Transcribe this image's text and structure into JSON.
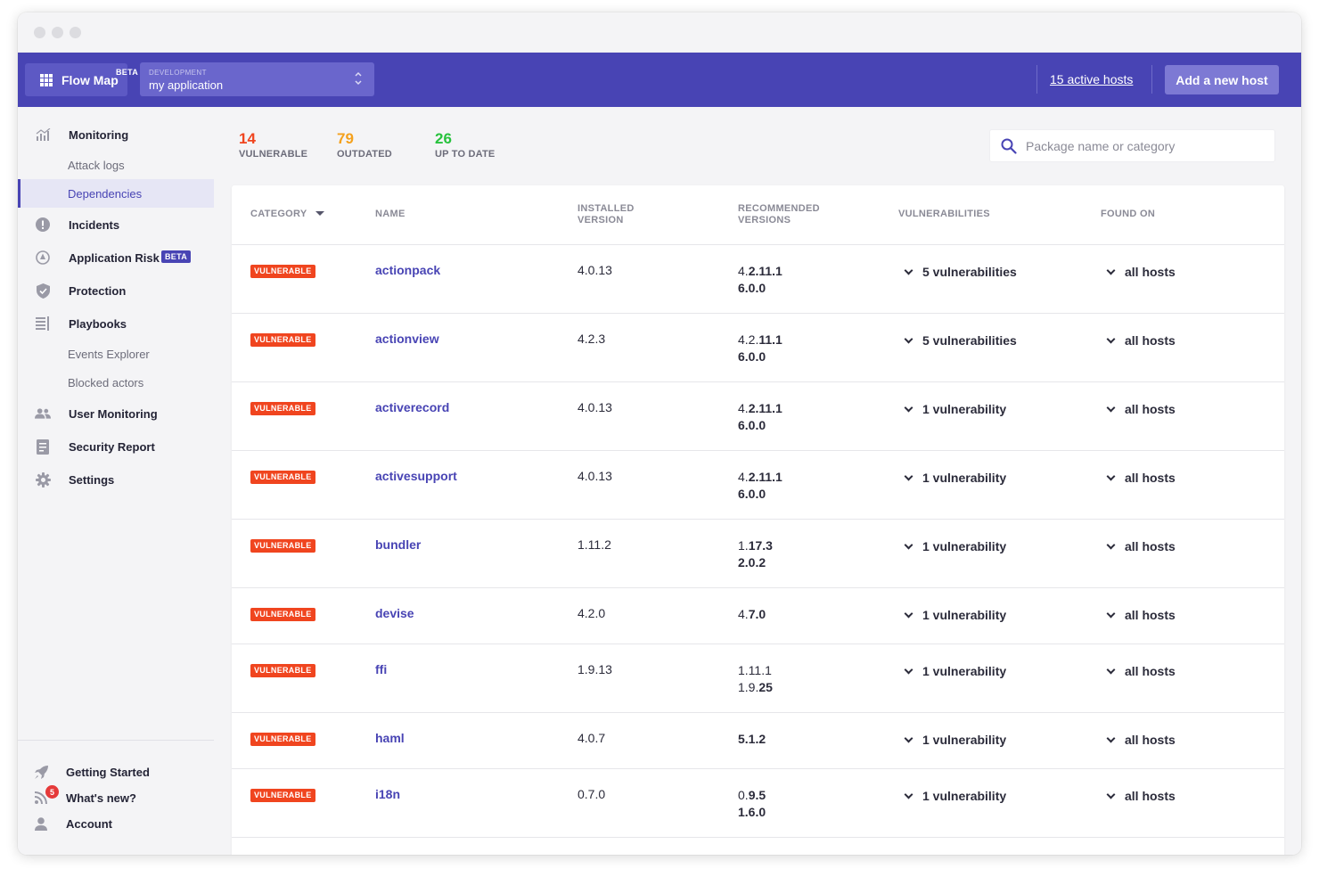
{
  "topbar": {
    "flowmap_label": "Flow Map",
    "flowmap_badge": "BETA",
    "env_label": "DEVELOPMENT",
    "app_name": "my application",
    "active_hosts": "15 active hosts",
    "add_host": "Add a new host"
  },
  "sidebar": {
    "monitoring": "Monitoring",
    "attack_logs": "Attack logs",
    "dependencies": "Dependencies",
    "incidents": "Incidents",
    "application_risk": "Application Risk",
    "application_risk_badge": "BETA",
    "protection": "Protection",
    "playbooks": "Playbooks",
    "events_explorer": "Events Explorer",
    "blocked_actors": "Blocked actors",
    "user_monitoring": "User Monitoring",
    "security_report": "Security Report",
    "settings": "Settings",
    "getting_started": "Getting Started",
    "whats_new": "What's new?",
    "whats_new_count": "5",
    "account": "Account"
  },
  "stats": {
    "vulnerable": {
      "count": "14",
      "label": "VULNERABLE",
      "color": "#f0451f"
    },
    "outdated": {
      "count": "79",
      "label": "OUTDATED",
      "color": "#f4a11d"
    },
    "up_to_date": {
      "count": "26",
      "label": "UP TO DATE",
      "color": "#27c23d"
    }
  },
  "search": {
    "placeholder": "Package name or category"
  },
  "table": {
    "headers": {
      "category": "CATEGORY",
      "name": "NAME",
      "installed_l1": "INSTALLED",
      "installed_l2": "VERSION",
      "recommended_l1": "RECOMMENDED",
      "recommended_l2": "VERSIONS",
      "vulnerabilities": "VULNERABILITIES",
      "found_on": "FOUND ON"
    },
    "rows": [
      {
        "category": "VULNERABLE",
        "name": "actionpack",
        "installed": "4.0.13",
        "recommended": [
          [
            "4.",
            "2.11.1"
          ],
          [
            "",
            "6.0.0"
          ]
        ],
        "vulnerabilities": "5 vulnerabilities",
        "found_on": "all hosts"
      },
      {
        "category": "VULNERABLE",
        "name": "actionview",
        "installed": "4.2.3",
        "recommended": [
          [
            "4.2.",
            "11.1"
          ],
          [
            "",
            "6.0.0"
          ]
        ],
        "vulnerabilities": "5 vulnerabilities",
        "found_on": "all hosts"
      },
      {
        "category": "VULNERABLE",
        "name": "activerecord",
        "installed": "4.0.13",
        "recommended": [
          [
            "4.",
            "2.11.1"
          ],
          [
            "",
            "6.0.0"
          ]
        ],
        "vulnerabilities": "1 vulnerability",
        "found_on": "all hosts"
      },
      {
        "category": "VULNERABLE",
        "name": "activesupport",
        "installed": "4.0.13",
        "recommended": [
          [
            "4.",
            "2.11.1"
          ],
          [
            "",
            "6.0.0"
          ]
        ],
        "vulnerabilities": "1 vulnerability",
        "found_on": "all hosts"
      },
      {
        "category": "VULNERABLE",
        "name": "bundler",
        "installed": "1.11.2",
        "recommended": [
          [
            "1.",
            "17.3"
          ],
          [
            "",
            "2.0.2"
          ]
        ],
        "vulnerabilities": "1 vulnerability",
        "found_on": "all hosts"
      },
      {
        "category": "VULNERABLE",
        "name": "devise",
        "installed": "4.2.0",
        "recommended": [
          [
            "4.",
            "7.0"
          ]
        ],
        "vulnerabilities": "1 vulnerability",
        "found_on": "all hosts"
      },
      {
        "category": "VULNERABLE",
        "name": "ffi",
        "installed": "1.9.13",
        "recommended": [
          [
            "1.11.1",
            ""
          ],
          [
            "1.9.",
            "25"
          ]
        ],
        "vulnerabilities": "1 vulnerability",
        "found_on": "all hosts"
      },
      {
        "category": "VULNERABLE",
        "name": "haml",
        "installed": "4.0.7",
        "recommended": [
          [
            "",
            "5.1.2"
          ]
        ],
        "vulnerabilities": "1 vulnerability",
        "found_on": "all hosts"
      },
      {
        "category": "VULNERABLE",
        "name": "i18n",
        "installed": "0.7.0",
        "recommended": [
          [
            "0.",
            "9.5"
          ],
          [
            "",
            "1.6.0"
          ]
        ],
        "vulnerabilities": "1 vulnerability",
        "found_on": "all hosts"
      }
    ]
  }
}
